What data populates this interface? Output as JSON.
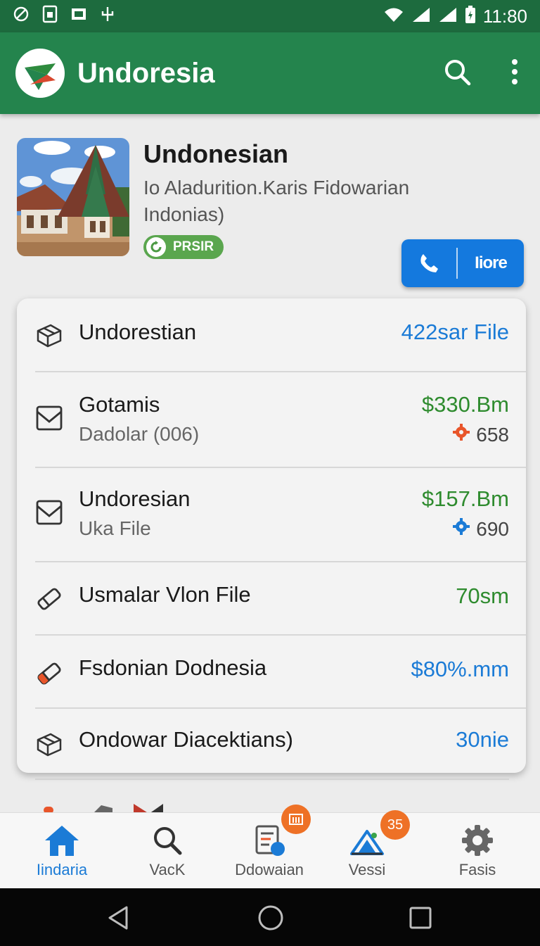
{
  "status_bar": {
    "time": "11:80",
    "left_icons": [
      "no-sim-icon",
      "sim-card-icon",
      "screenshot-icon",
      "usb-icon"
    ],
    "right_icons": [
      "wifi-icon",
      "signal-icon",
      "signal-icon",
      "battery-icon"
    ]
  },
  "app_bar": {
    "title": "Undoresia",
    "logo": "app-logo-icon",
    "actions": [
      "search-icon",
      "more-vert-icon"
    ]
  },
  "header": {
    "title": "Undonesian",
    "subtitle": "Io Aladurition.Karis Fidowarian Indonias)",
    "badge_label": "PRSIR",
    "call_button_label": "Iiore",
    "colors": {
      "badge": "#5aa64e",
      "call_button": "#1479de"
    }
  },
  "list": [
    {
      "title": "Undorestian",
      "value": "422sar File",
      "value_color": "#1b7bd6",
      "icon": "package-icon"
    },
    {
      "title": "Gotamis",
      "subtitle": "Dadolar (006)",
      "value": "$330.Bm",
      "value_color": "#2e8b2e",
      "count": "658",
      "count_icon": "gear-icon",
      "count_icon_color": "#e8552a",
      "icon": "mail-icon"
    },
    {
      "title": "Undoresian",
      "subtitle": "Uka File",
      "value": "$157.Bm",
      "value_color": "#2e8b2e",
      "count": "690",
      "count_icon": "gear-icon",
      "count_icon_color": "#1b7bd6",
      "icon": "mail-icon"
    },
    {
      "title": "Usmalar Vlon File",
      "value": "70sm",
      "value_color": "#2e8b2e",
      "icon": "eraser-icon"
    },
    {
      "title": "Fsdonian Dodnesia",
      "value": "$80%.mm",
      "value_color": "#1b7bd6",
      "icon": "eraser-icon"
    },
    {
      "title": "Ondowar Diacektians)",
      "value": "30nie",
      "value_color": "#1b7bd6",
      "icon": "package-icon"
    }
  ],
  "bottom_nav": [
    {
      "label": "Iindaria",
      "icon": "home-icon",
      "active": true
    },
    {
      "label": "VacK",
      "icon": "search-icon",
      "active": false
    },
    {
      "label": "Ddowaian",
      "icon": "document-icon",
      "active": false,
      "badge_icon": "list-icon"
    },
    {
      "label": "Vessi",
      "icon": "chart-icon",
      "active": false,
      "badge": "35"
    },
    {
      "label": "Fasis",
      "icon": "settings-icon",
      "active": false
    }
  ],
  "system_nav": [
    "back-icon",
    "home-circle-icon",
    "recents-icon"
  ]
}
